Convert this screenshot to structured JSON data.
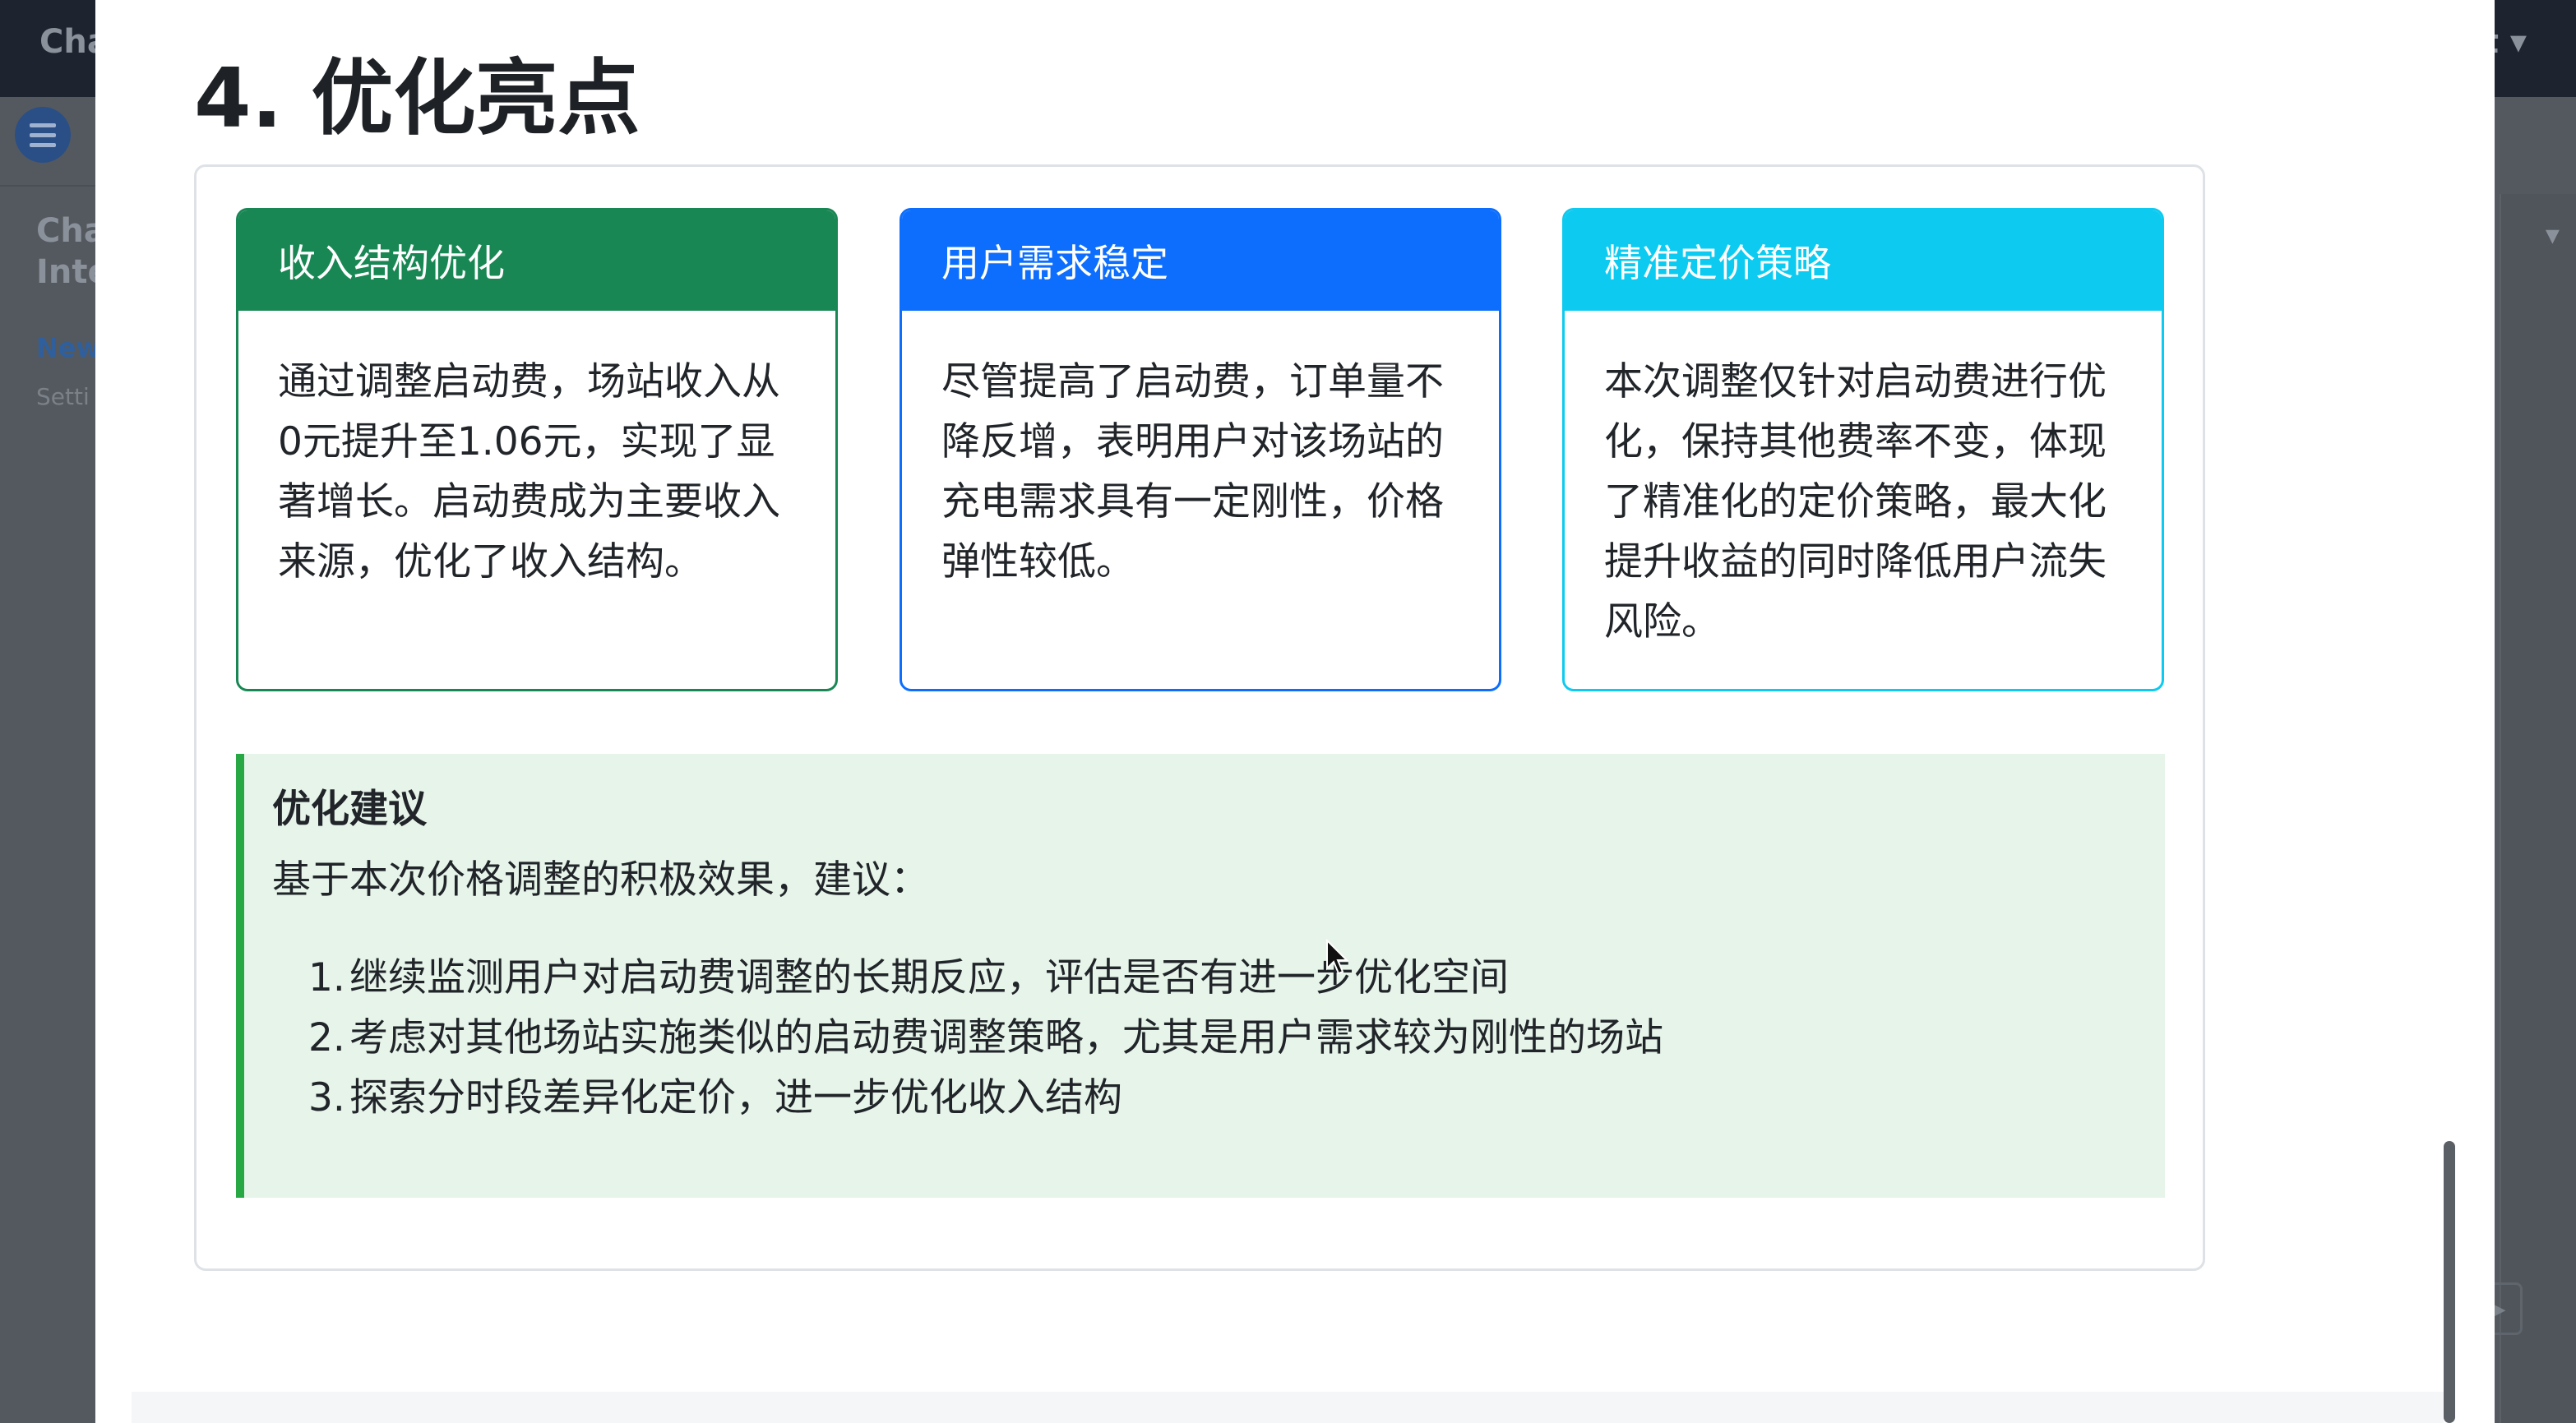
{
  "background_app": {
    "app_title": "Cha",
    "top_right_label": "t",
    "sidebar_title_line1": "Cha",
    "sidebar_title_line2": "Inte",
    "sidebar_new": "New",
    "sidebar_settings": "Setti"
  },
  "report": {
    "section_title": "4. 优化亮点",
    "cards": [
      {
        "header": "收入结构优化",
        "body": "通过调整启动费，场站收入从0元提升至1.06元，实现了显著增长。启动费成为主要收入来源，优化了收入结构。"
      },
      {
        "header": "用户需求稳定",
        "body": "尽管提高了启动费，订单量不降反增，表明用户对该场站的充电需求具有一定刚性，价格弹性较低。"
      },
      {
        "header": "精准定价策略",
        "body": "本次调整仅针对启动费进行优化，保持其他费率不变，体现了精准化的定价策略，最大化提升收益的同时降低用户流失风险。"
      }
    ],
    "advice": {
      "title": "优化建议",
      "intro": "基于本次价格调整的积极效果，建议：",
      "items": [
        {
          "num": "1.",
          "text": "继续监测用户对启动费调整的长期反应，评估是否有进一步优化空间"
        },
        {
          "num": "2.",
          "text": "考虑对其他场站实施类似的启动费调整策略，尤其是用户需求较为刚性的场站"
        },
        {
          "num": "3.",
          "text": "探索分时段差异化定价，进一步优化收入结构"
        }
      ]
    }
  },
  "colors": {
    "card1_accent": "#198754",
    "card2_accent": "#0d6efd",
    "card3_accent": "#0dcaf0",
    "advice_bg": "#e6f4ea",
    "advice_border": "#28a745"
  }
}
